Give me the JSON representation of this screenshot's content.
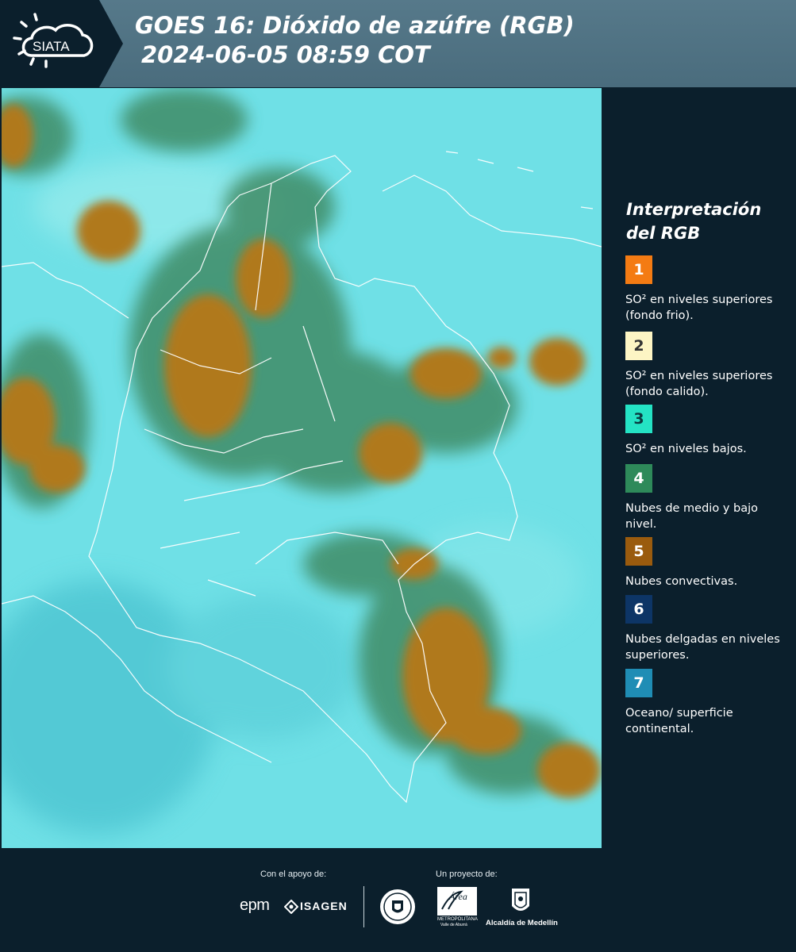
{
  "header": {
    "logo_text": "SIATA",
    "title_line1": "GOES 16: Dióxido de azúfre (RGB)",
    "title_line2": "2024-06-05 08:59 COT"
  },
  "legend": {
    "title_line1": "Interpretación",
    "title_line2": "del RGB",
    "items": [
      {
        "number": "1",
        "color": "#f47b13",
        "text_color": "#ffffff",
        "label": "SO² en niveles superiores (fondo frio)."
      },
      {
        "number": "2",
        "color": "#fdf5c4",
        "text_color": "#333333",
        "label": "SO² en niveles superiores (fondo calido)."
      },
      {
        "number": "3",
        "color": "#24e3c4",
        "text_color": "#0b3a40",
        "label": "SO² en niveles bajos."
      },
      {
        "number": "4",
        "color": "#2e8a5a",
        "text_color": "#ffffff",
        "label": "Nubes de medio y bajo nivel."
      },
      {
        "number": "5",
        "color": "#9a5b0e",
        "text_color": "#ffffff",
        "label": "Nubes convectivas."
      },
      {
        "number": "6",
        "color": "#0d3566",
        "text_color": "#ffffff",
        "label": "Nubes delgadas en niveles superiores."
      },
      {
        "number": "7",
        "color": "#1f8db5",
        "text_color": "#ffffff",
        "label": "Oceano/ superficie continental."
      }
    ]
  },
  "footer": {
    "support_label": "Con el apoyo de:",
    "project_label": "Un proyecto de:",
    "epm_text": "epm",
    "isagen_text": "ISAGEN",
    "area_text": "Área",
    "area_sub1": "METROPOLITANA",
    "area_sub2": "Valle de Aburrá",
    "alcaldia_text": "Alcaldía de Medellín"
  },
  "colors": {
    "header": "#4f7383",
    "background": "#0b1f2c",
    "ocean": "#6fe0e6",
    "cloud_convective": "#b0791e",
    "cloud_mid": "#3f8c66"
  }
}
